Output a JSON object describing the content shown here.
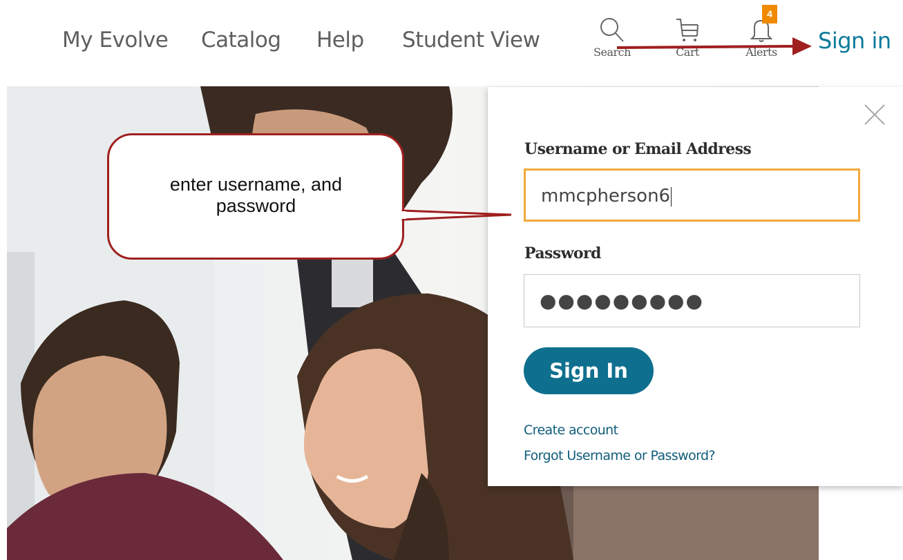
{
  "nav": {
    "items": [
      {
        "label": "My Evolve"
      },
      {
        "label": "Catalog"
      },
      {
        "label": "Help"
      },
      {
        "label": "Student View"
      }
    ],
    "search_label": "Search",
    "cart_label": "Cart",
    "alerts_label": "Alerts",
    "alerts_count": "4",
    "signin_label": "Sign in"
  },
  "annotation": {
    "callout_text": "enter username, and password",
    "color": "#a01f1f"
  },
  "login": {
    "username_label": "Username or Email Address",
    "username_value": "mmcpherson6",
    "password_label": "Password",
    "password_value": "●●●●●●●●●",
    "submit_label": "Sign In",
    "create_account": "Create account",
    "forgot": "Forgot Username or Password?"
  },
  "colors": {
    "brand": "#0f6f8e",
    "link": "#0c7a9a",
    "badge": "#f08a00",
    "focus": "#f2a93b"
  }
}
